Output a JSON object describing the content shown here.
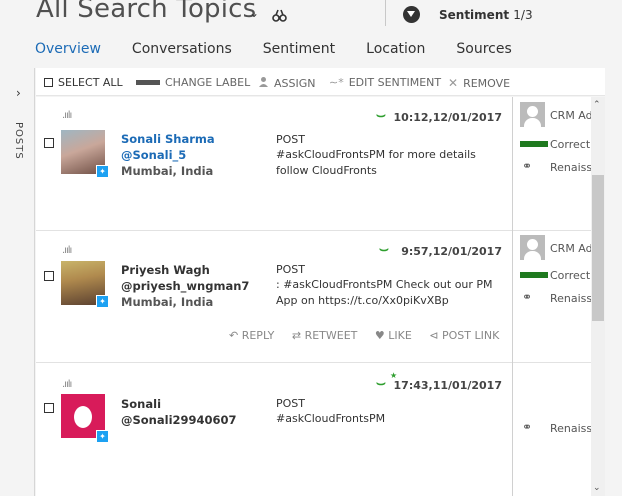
{
  "header": {
    "title": "All Search Topics",
    "sentiment_label": "Sentiment",
    "sentiment_page": "1/3"
  },
  "tabs": [
    "Overview",
    "Conversations",
    "Sentiment",
    "Location",
    "Sources"
  ],
  "rail": {
    "label": "POSTS"
  },
  "toolbar": {
    "select_all": "SELECT ALL",
    "change_label": "CHANGE LABEL",
    "assign": "ASSIGN",
    "edit_sentiment": "EDIT SENTIMENT",
    "remove": "REMOVE"
  },
  "posts": [
    {
      "time": "10:12,12/01/2017",
      "name": "Sonali Sharma",
      "handle": "@Sonali_5",
      "location": "Mumbai, India",
      "type": "POST",
      "text": "#askCloudFrontsPM for more details follow CloudFronts",
      "side_name": "CRM Admin",
      "side_status": "Correct",
      "side_link": "Renaissance"
    },
    {
      "time": "9:57,12/01/2017",
      "name": "Priyesh Wagh",
      "handle": "@priyesh_wngman7",
      "location": "Mumbai, India",
      "type": "POST",
      "text": ": #askCloudFrontsPM Check out our PM App on https://t.co/Xx0piKvXBp",
      "side_name": "CRM Admin",
      "side_status": "Correct",
      "side_link": "Renaissance",
      "actions": {
        "reply": "REPLY",
        "retweet": "RETWEET",
        "like": "LIKE",
        "post_link": "POST LINK"
      }
    },
    {
      "time": "17:43,11/01/2017",
      "name": "Sonali",
      "handle": "@Sonali29940607",
      "type": "POST",
      "text": "#askCloudFrontsPM",
      "side_link": "Renaissance"
    }
  ],
  "colors": {
    "accent": "#1c6bb6",
    "positive": "#2e9e2e",
    "status_bar": "#1f7a1f",
    "twitter": "#1da1f2"
  }
}
